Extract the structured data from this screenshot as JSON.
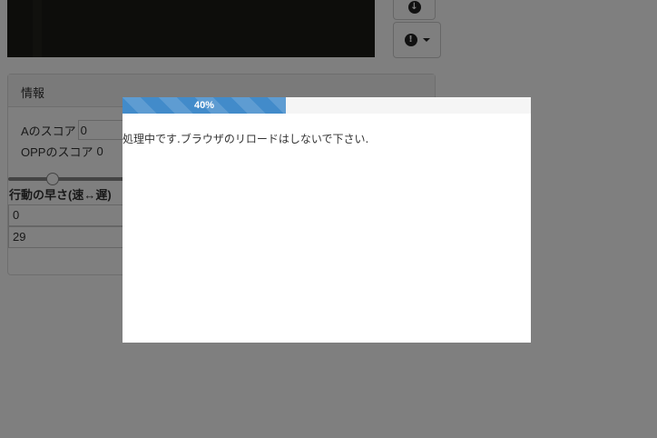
{
  "info_panel": {
    "heading": "情報",
    "score_a_label": "Aのスコア",
    "score_a_value": "0",
    "score_opp_label": "OPPのスコア",
    "score_opp_value": "0",
    "speed_label": "行動の早さ(速↔遅)",
    "speed_min": "0",
    "speed_max": "29",
    "speed_slider_fraction": 0.35
  },
  "side_buttons": {
    "download_icon": "download-icon",
    "alert_icon": "exclamation-circle-icon",
    "alert_glyph": "!"
  },
  "modal": {
    "progress_percent": 40,
    "progress_label": "40%",
    "message": "処理中です.ブラウザのリロードはしないで下さい."
  },
  "colors": {
    "progress_bar": "#428bca",
    "overlay": "rgba(0,0,0,0.5)"
  }
}
